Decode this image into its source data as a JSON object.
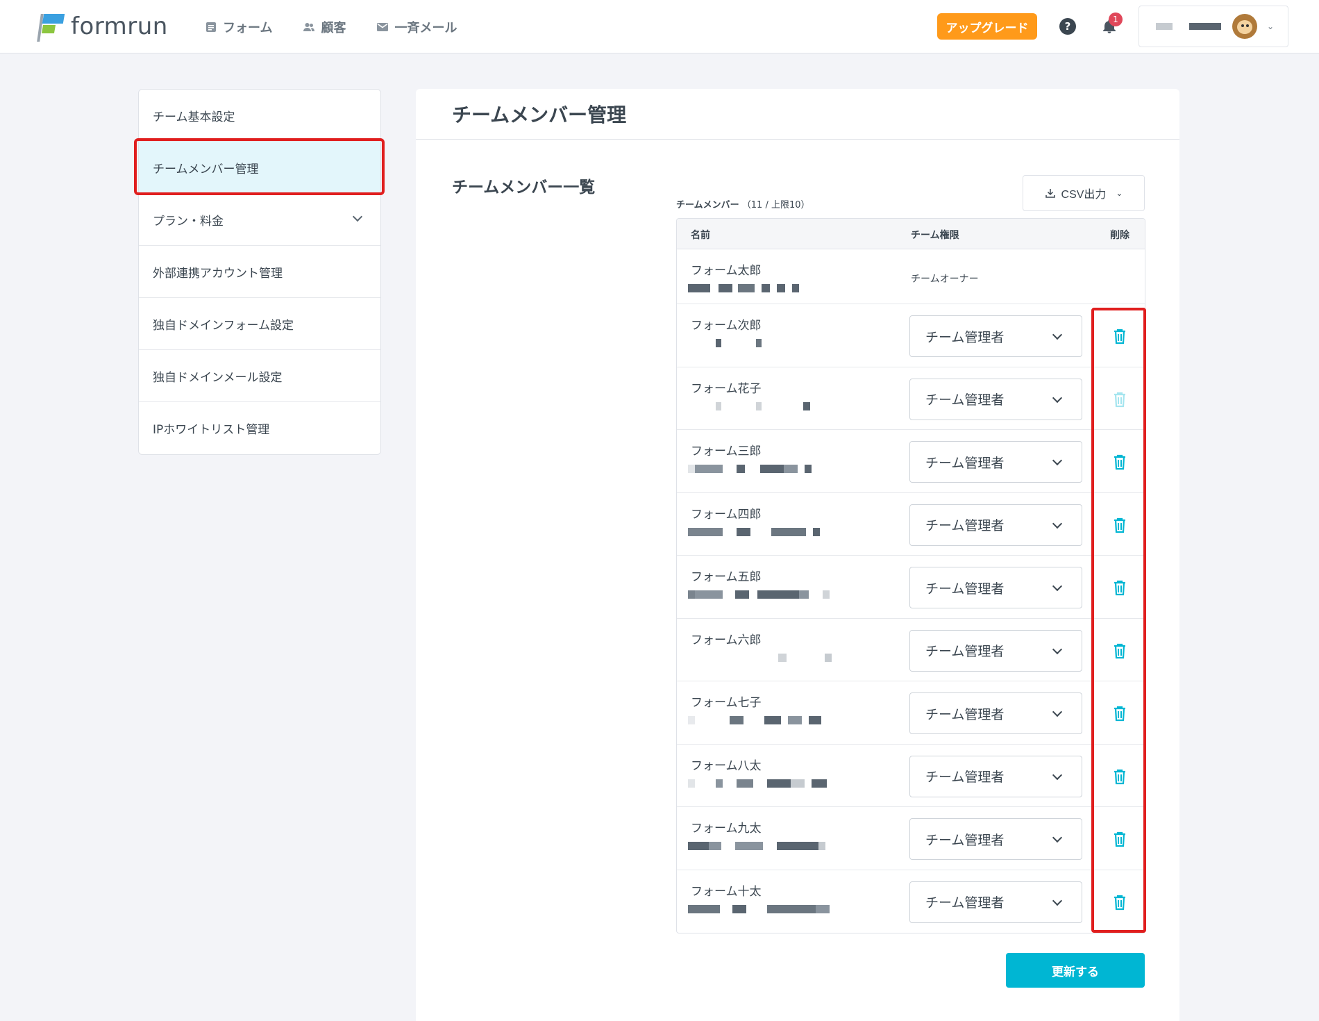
{
  "header": {
    "logo_text": "formrun",
    "nav": [
      {
        "label": "フォーム",
        "icon": "form-icon"
      },
      {
        "label": "顧客",
        "icon": "people-icon"
      },
      {
        "label": "一斉メール",
        "icon": "mail-icon"
      }
    ],
    "upgrade_label": "アップグレード",
    "help_label": "?",
    "notification_count": "1"
  },
  "sidebar": {
    "items": [
      {
        "label": "チーム基本設定"
      },
      {
        "label": "チームメンバー管理",
        "active": true
      },
      {
        "label": "プラン・料金",
        "has_chevron": true
      },
      {
        "label": "外部連携アカウント管理"
      },
      {
        "label": "独自ドメインフォーム設定"
      },
      {
        "label": "独自ドメインメール設定"
      },
      {
        "label": "IPホワイトリスト管理"
      }
    ]
  },
  "main": {
    "title": "チームメンバー管理",
    "section_title": "チームメンバー一覧",
    "member_label": "チームメンバー",
    "member_count": "（11 / 上限10）",
    "csv_button": "CSV出力",
    "table_headers": {
      "name": "名前",
      "role": "チーム権限",
      "delete": "削除"
    },
    "owner": {
      "name": "フォーム太郎",
      "role": "チームオーナー"
    },
    "members": [
      {
        "name": "フォーム次郎",
        "role": "チーム管理者",
        "delete_enabled": true
      },
      {
        "name": "フォーム花子",
        "role": "チーム管理者",
        "delete_enabled": false
      },
      {
        "name": "フォーム三郎",
        "role": "チーム管理者",
        "delete_enabled": true
      },
      {
        "name": "フォーム四郎",
        "role": "チーム管理者",
        "delete_enabled": true
      },
      {
        "name": "フォーム五郎",
        "role": "チーム管理者",
        "delete_enabled": true
      },
      {
        "name": "フォーム六郎",
        "role": "チーム管理者",
        "delete_enabled": true
      },
      {
        "name": "フォーム七子",
        "role": "チーム管理者",
        "delete_enabled": true
      },
      {
        "name": "フォーム八太",
        "role": "チーム管理者",
        "delete_enabled": true
      },
      {
        "name": "フォーム九太",
        "role": "チーム管理者",
        "delete_enabled": true
      },
      {
        "name": "フォーム十太",
        "role": "チーム管理者",
        "delete_enabled": true
      }
    ],
    "update_button": "更新する"
  },
  "colors": {
    "accent": "#00b6d3",
    "upgrade": "#ff9a1a",
    "highlight": "#e01e1e",
    "badge": "#e0475a"
  }
}
